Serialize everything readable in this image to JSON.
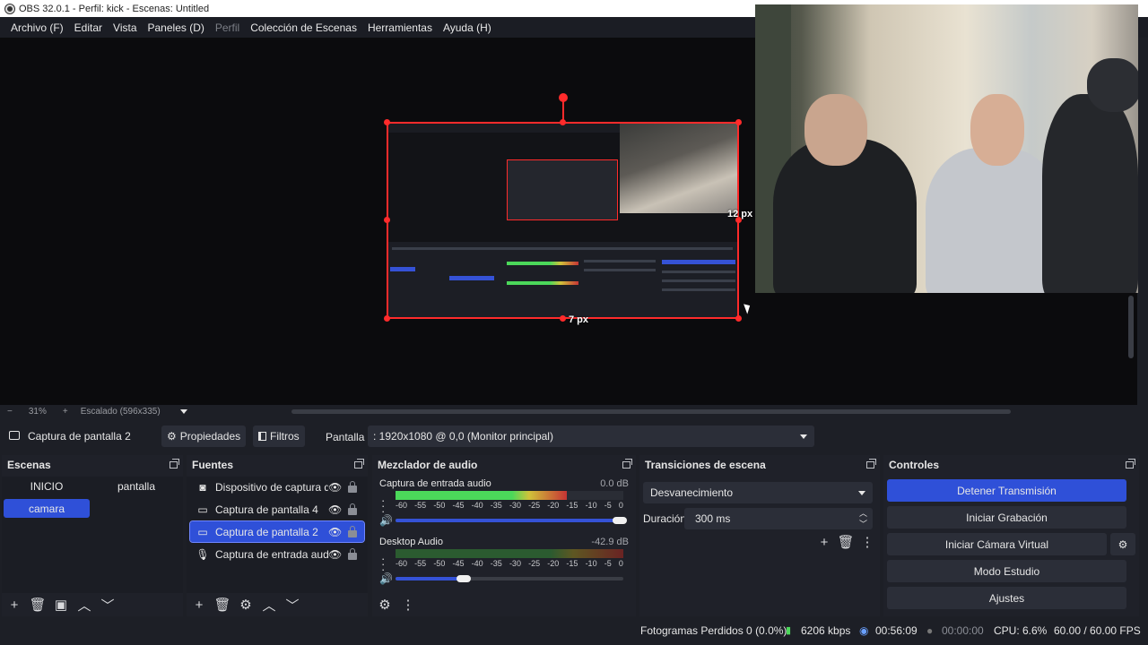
{
  "window": {
    "title": "OBS 32.0.1 - Perfil: kick - Escenas: Untitled"
  },
  "menu": [
    "Archivo (F)",
    "Editar",
    "Vista",
    "Paneles (D)",
    "Perfil",
    "Colección de Escenas",
    "Herramientas",
    "Ayuda (H)"
  ],
  "preview": {
    "px_right": "12 px",
    "px_bottom": "7 px",
    "zoom_minus": "−",
    "zoom": "31%",
    "zoom_plus": "+",
    "scaled": "Escalado (596x335)"
  },
  "toolbar": {
    "source_name": "Captura de pantalla 2",
    "properties": "Propiedades",
    "filters": "Filtros",
    "display_label": "Pantalla",
    "display_value": ": 1920x1080 @ 0,0 (Monitor principal)"
  },
  "scenes": {
    "title": "Escenas",
    "items": [
      "INICIO",
      "pantalla",
      "camara"
    ],
    "active": "camara"
  },
  "sources": {
    "title": "Fuentes",
    "items": [
      {
        "icon": "camera-icon",
        "label": "Dispositivo de captura de"
      },
      {
        "icon": "monitor-icon",
        "label": "Captura de pantalla 4"
      },
      {
        "icon": "monitor-icon",
        "label": "Captura de pantalla 2"
      },
      {
        "icon": "microphone-icon",
        "label": "Captura de entrada audic"
      }
    ],
    "active_index": 2
  },
  "mixer": {
    "title": "Mezclador de audio",
    "tracks": [
      {
        "name": "Captura de entrada audio",
        "db": "0.0 dB",
        "level": 0.75,
        "volume": 1.0
      },
      {
        "name": "Desktop Audio",
        "db": "-42.9 dB",
        "level": 0.0,
        "volume": 0.3
      }
    ],
    "ticks": [
      "-60",
      "-55",
      "-50",
      "-45",
      "-40",
      "-35",
      "-30",
      "-25",
      "-20",
      "-15",
      "-10",
      "-5",
      "0"
    ]
  },
  "transitions": {
    "title": "Transiciones de escena",
    "selected": "Desvanecimiento",
    "duration_label": "Duración",
    "duration_value": "300 ms"
  },
  "controls": {
    "title": "Controles",
    "stop_stream": "Detener Transmisión",
    "start_recording": "Iniciar Grabación",
    "start_virtual_cam": "Iniciar Cámara Virtual",
    "studio_mode": "Modo Estudio",
    "settings": "Ajustes"
  },
  "status": {
    "dropped_frames": "Fotogramas Perdidos 0 (0.0%)",
    "bitrate": "6206 kbps",
    "stream_time": "00:56:09",
    "rec_time": "00:00:00",
    "cpu": "CPU: 6.6%",
    "fps": "60.00 / 60.00 FPS"
  },
  "colors": {
    "accent": "#2f50d8",
    "selection": "#ff2b2b",
    "meter_green": "#4bd85a",
    "meter_yellow": "#d0c23a",
    "meter_red": "#c63434"
  }
}
